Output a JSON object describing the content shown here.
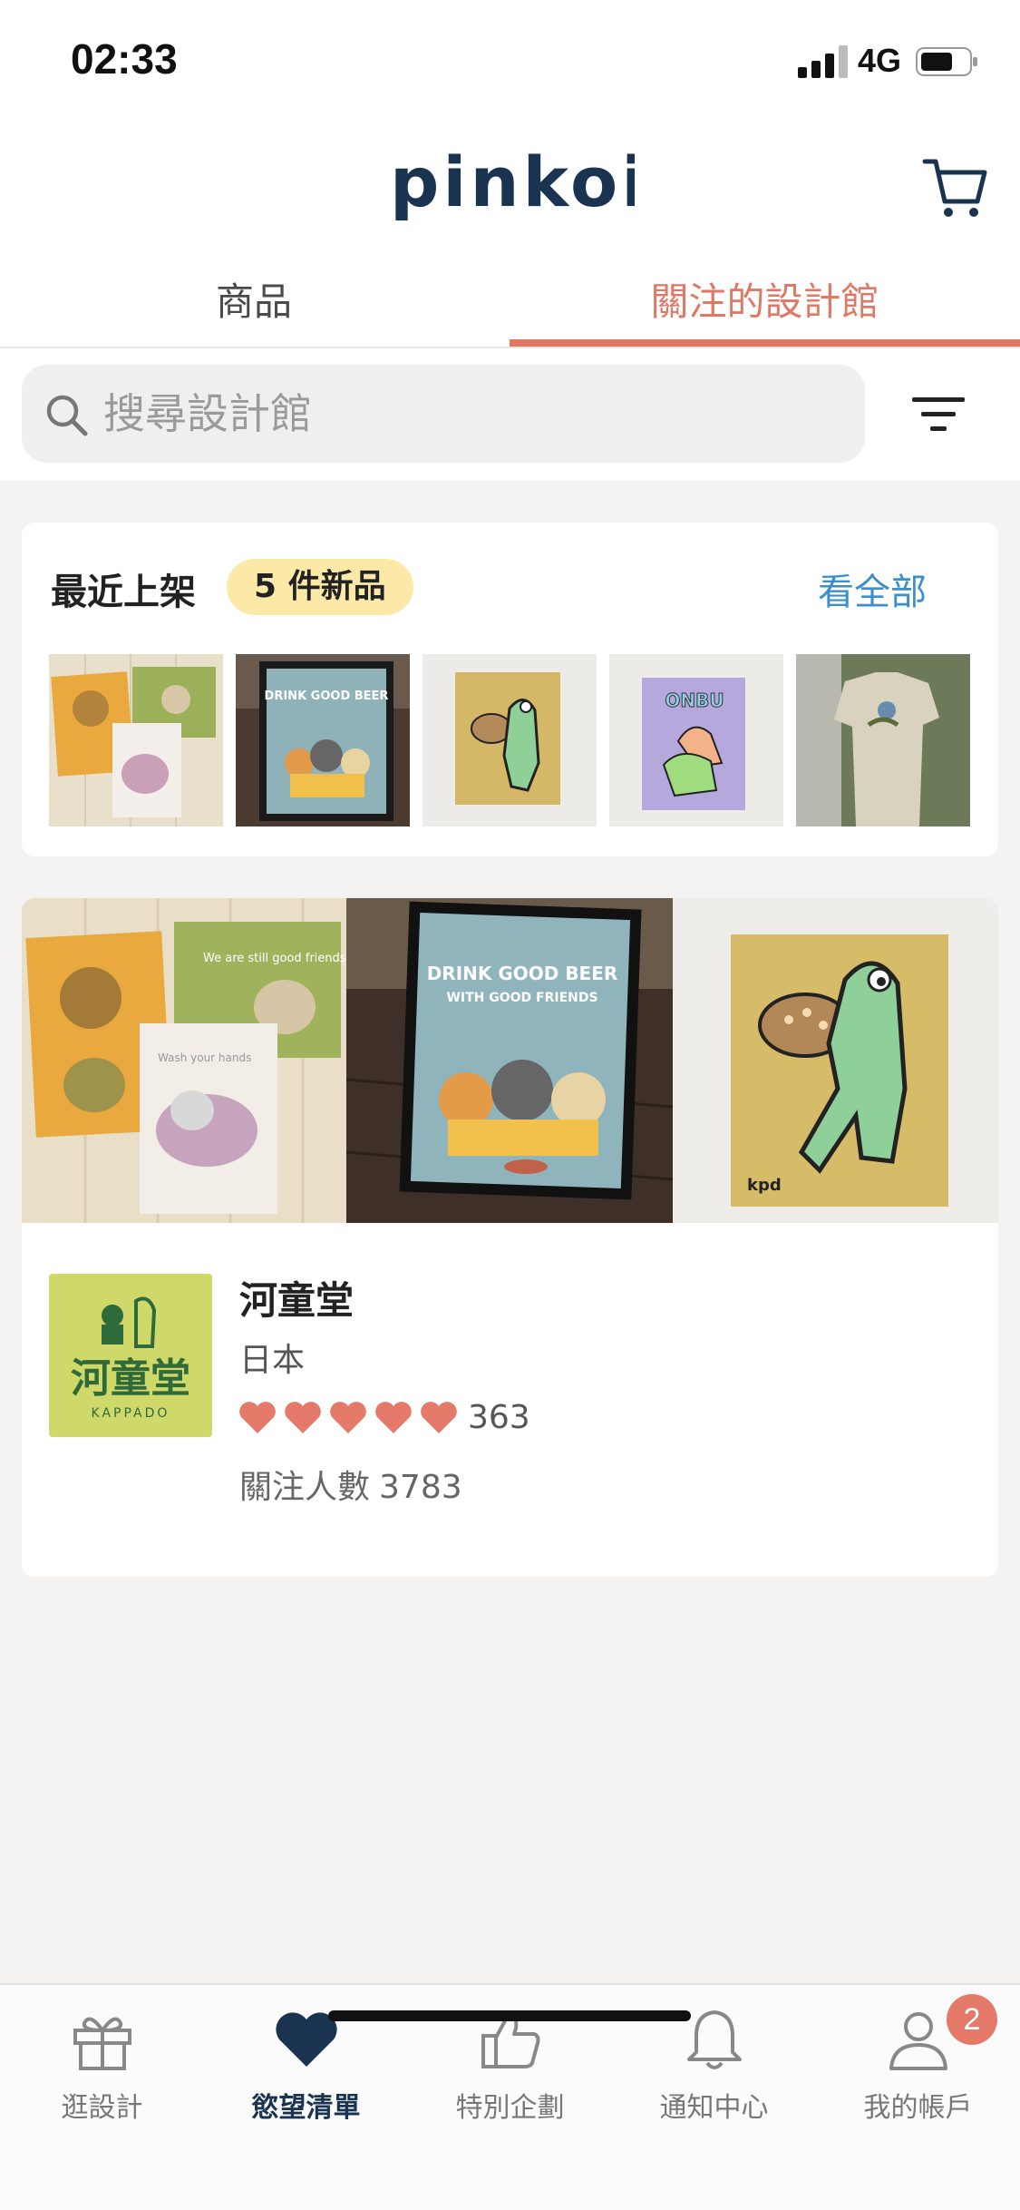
{
  "status_bar": {
    "time": "02:33",
    "network": "4G"
  },
  "header": {
    "logo_text": "pinkoi"
  },
  "tabs": [
    {
      "label": "商品",
      "active": false
    },
    {
      "label": "關注的設計館",
      "active": true
    }
  ],
  "search": {
    "placeholder": "搜尋設計館",
    "value": ""
  },
  "new_arrivals": {
    "title": "最近上架",
    "badge": "5 件新品",
    "see_all": "看全部",
    "thumbnails": [
      "postcards",
      "drink-good-beer-poster",
      "frog-mushroom-painting",
      "onbu-frog-painting",
      "tshirt-model"
    ]
  },
  "shop": {
    "name": "河童堂",
    "country": "日本",
    "rating_hearts": 5,
    "rating_count": "363",
    "followers_label": "關注人數",
    "followers_count": "3783",
    "logo_text": "河童堂",
    "logo_subtext": "KAPPADO",
    "banner_images": [
      "postcards",
      "drink-good-beer-poster",
      "frog-mushroom-painting"
    ]
  },
  "bottom_nav": {
    "items": [
      {
        "label": "逛設計",
        "icon": "gift-icon",
        "active": false
      },
      {
        "label": "慾望清單",
        "icon": "heart-icon",
        "active": true
      },
      {
        "label": "特別企劃",
        "icon": "thumbs-up-icon",
        "active": false
      },
      {
        "label": "通知中心",
        "icon": "bell-icon",
        "active": false
      },
      {
        "label": "我的帳戶",
        "icon": "user-icon",
        "active": false
      }
    ],
    "account_badge": "2"
  },
  "colors": {
    "accent": "#e07865",
    "link": "#3d8fc9",
    "brand_navy": "#1a3350",
    "badge_bg": "#fce9a8"
  }
}
